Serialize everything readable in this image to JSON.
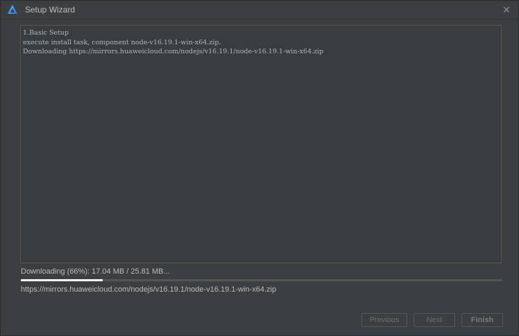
{
  "window": {
    "title": "Setup Wizard",
    "app_icon": "triangle-logo-icon",
    "close_icon": "close-icon",
    "close_glyph": "✕"
  },
  "log": {
    "lines": [
      "1.Basic Setup",
      "execute install task, component node-v16.19.1-win-x64.zip.",
      "Downloading https://mirrors.huaweicloud.com/nodejs/v16.19.1/node-v16.19.1-win-x64.zip"
    ]
  },
  "progress": {
    "label": "Downloading (66%): 17.04 MB / 25.81 MB...",
    "fraction": 0.17,
    "url": "https://mirrors.huaweicloud.com/nodejs/v16.19.1/node-v16.19.1-win-x64.zip"
  },
  "buttons": {
    "previous": "Previous",
    "next": "Next",
    "finish": "Finish"
  },
  "colors": {
    "background": "#3c3f41",
    "accent": "#3592c4"
  }
}
